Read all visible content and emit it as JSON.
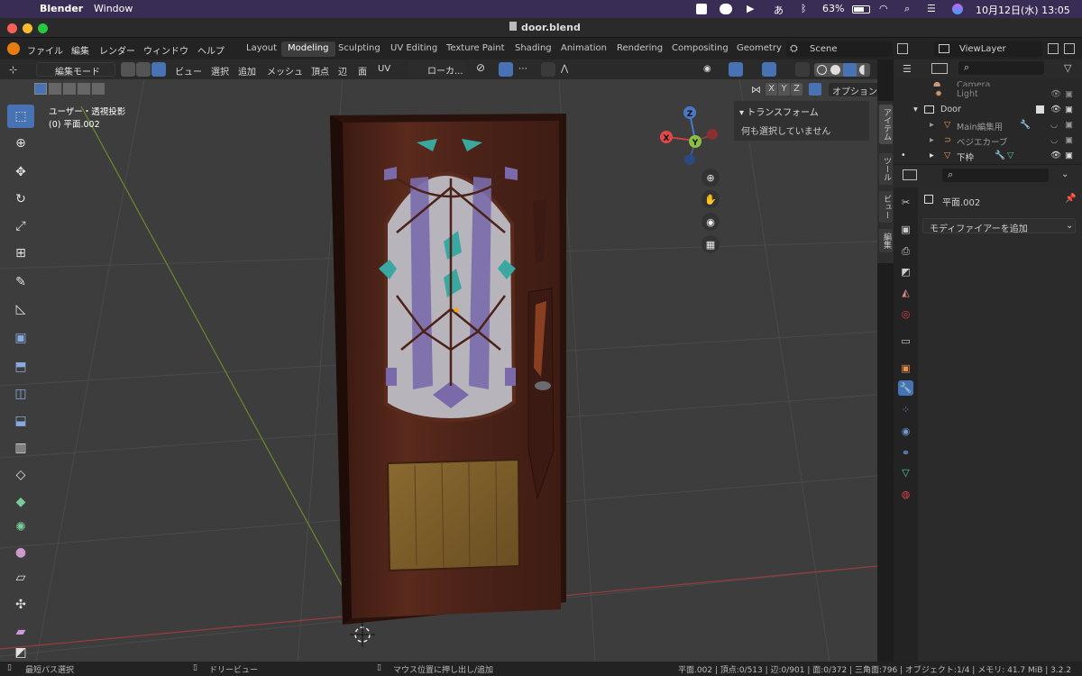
{
  "macbar": {
    "apple": "",
    "app": "Blender",
    "menu": "Window",
    "battery": "63%",
    "ime": "あ",
    "datetime": "10月12日(水)  13:05"
  },
  "window": {
    "title": "door.blend"
  },
  "topmenu": [
    "ファイル",
    "編集",
    "レンダー",
    "ウィンドウ",
    "ヘルプ"
  ],
  "workspaces": [
    "Layout",
    "Modeling",
    "Sculpting",
    "UV Editing",
    "Texture Paint",
    "Shading",
    "Animation",
    "Rendering",
    "Compositing",
    "Geometry"
  ],
  "active_workspace": "Modeling",
  "scene": "Scene",
  "viewlayer": "ViewLayer",
  "header": {
    "mode": "編集モード",
    "menus": [
      "ビュー",
      "選択",
      "追加",
      "メッシュ",
      "頂点",
      "辺",
      "面",
      "UV"
    ],
    "orientation": "ローカ...",
    "xyz": [
      "X",
      "Y",
      "Z"
    ],
    "options": "オプション"
  },
  "viewport": {
    "view_name": "ユーザー・透視投影",
    "object_label": "(0) 平面.002"
  },
  "npanel": {
    "section": "トランスフォーム",
    "message": "何も選択していません"
  },
  "vtabs": [
    "アイテム",
    "ツール",
    "ビュー",
    "編集"
  ],
  "gizmo": {
    "x": "X",
    "y": "Y",
    "z": "Z"
  },
  "outliner": {
    "rows": [
      {
        "name": "Camera",
        "dim": true
      },
      {
        "name": "Light",
        "dim": true
      },
      {
        "name": "Door",
        "dim": false
      },
      {
        "name": "Main編集用",
        "dim": true
      },
      {
        "name": "ベジエカーブ",
        "dim": true
      },
      {
        "name": "下枠",
        "dim": false
      }
    ]
  },
  "properties": {
    "object_name": "平面.002",
    "add_modifier": "モディファイアーを追加"
  },
  "status": {
    "left": "最短パス選択",
    "mid": "ドリービュー",
    "mid2": "マウス位置に押し出し/追加",
    "stats": "平面.002 | 頂点:0/513 | 辺:0/901 | 面:0/372 | 三角面:796 | オブジェクト:1/4 | メモリ: 41.7 MiB | 3.2.2"
  },
  "colors": {
    "accent": "#4772b3",
    "viewport_bg": "#3d3d3d",
    "door_wood": "#4a2218",
    "glass_purple": "#7a6aaa",
    "glass_teal": "#3aa8a0"
  }
}
